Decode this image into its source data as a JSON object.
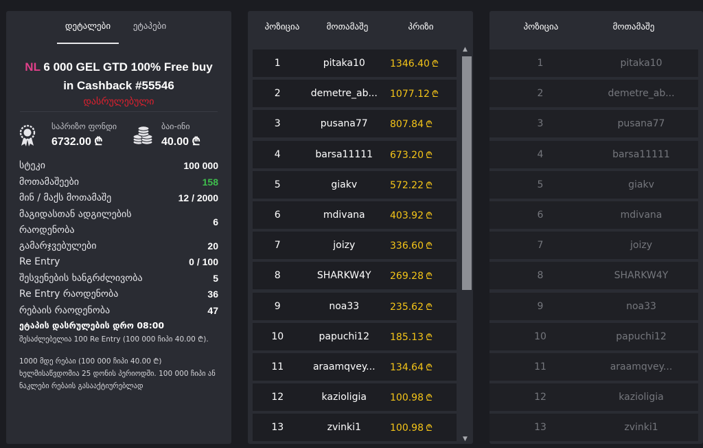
{
  "tabs": {
    "details": "დეტალები",
    "stages": "ეტაპები"
  },
  "tournament": {
    "prefix": "NL",
    "title": "6 000 GEL GTD 100% Free buy in Cashback #55546",
    "status": "დასრულებული"
  },
  "funds": {
    "prize_label": "საპრიზო ფონდი",
    "prize_value": "6732.00 ₾",
    "buyin_label": "ბაი-ინი",
    "buyin_value": "40.00 ₾"
  },
  "stats": [
    {
      "k": "სტეკი",
      "v": "100 000"
    },
    {
      "k": "მოთამაშეები",
      "v": "158"
    },
    {
      "k": "მინ / მაქს მოთამაშე",
      "v": "12 / 2000"
    },
    {
      "k": "მაგიდასთან ადგილების რაოდენობა",
      "v": "6"
    },
    {
      "k": "გამარჯვებულები",
      "v": "20"
    },
    {
      "k": "Re Entry",
      "v": "0 / 100"
    },
    {
      "k": "შესვენების ხანგრძლივობა",
      "v": "5"
    },
    {
      "k": "Re Entry რაოდენობა",
      "v": "36"
    },
    {
      "k": "რებაის რაოდენობა",
      "v": "47"
    }
  ],
  "notes": {
    "heading": "ეტაპის დასრულების დრო 08:00",
    "line1": "შესაძლებელია 100 Re Entry (100 000 ჩიპი 40.00 ₾).",
    "line2": "1000 მდე რებაი (100 000 ჩიპი 40.00 ₾) ხელმისაწვდომია 25 დონის პერიოდში. 100 000 ჩიპი ან ნაკლები რებაის გასააქტიურებლად"
  },
  "leaderboard": {
    "col_pos": "პოზიცია",
    "col_player": "მოთამაშე",
    "col_prize": "პრიზი",
    "rows": [
      {
        "pos": "1",
        "name": "pitaka10",
        "prize": "1346.40"
      },
      {
        "pos": "2",
        "name": "demetre_ab...",
        "prize": "1077.12"
      },
      {
        "pos": "3",
        "name": "pusana77",
        "prize": "807.84"
      },
      {
        "pos": "4",
        "name": "barsa11111",
        "prize": "673.20"
      },
      {
        "pos": "5",
        "name": "giakv",
        "prize": "572.22"
      },
      {
        "pos": "6",
        "name": "mdivana",
        "prize": "403.92"
      },
      {
        "pos": "7",
        "name": "joizy",
        "prize": "336.60"
      },
      {
        "pos": "8",
        "name": "SHARKW4Y",
        "prize": "269.28"
      },
      {
        "pos": "9",
        "name": "noa33",
        "prize": "235.62"
      },
      {
        "pos": "10",
        "name": "papuchi12",
        "prize": "185.13"
      },
      {
        "pos": "11",
        "name": "araamqvey...",
        "prize": "134.64"
      },
      {
        "pos": "12",
        "name": "kazioligia",
        "prize": "100.98"
      },
      {
        "pos": "13",
        "name": "zvinki1",
        "prize": "100.98"
      }
    ]
  },
  "players": {
    "col_pos": "პოზიცია",
    "col_player": "მოთამაშე",
    "rows": [
      {
        "pos": "1",
        "name": "pitaka10"
      },
      {
        "pos": "2",
        "name": "demetre_ab..."
      },
      {
        "pos": "3",
        "name": "pusana77"
      },
      {
        "pos": "4",
        "name": "barsa11111"
      },
      {
        "pos": "5",
        "name": "giakv"
      },
      {
        "pos": "6",
        "name": "mdivana"
      },
      {
        "pos": "7",
        "name": "joizy"
      },
      {
        "pos": "8",
        "name": "SHARKW4Y"
      },
      {
        "pos": "9",
        "name": "noa33"
      },
      {
        "pos": "10",
        "name": "papuchi12"
      },
      {
        "pos": "11",
        "name": "araamqvey..."
      },
      {
        "pos": "12",
        "name": "kazioligia"
      },
      {
        "pos": "13",
        "name": "zvinki1"
      }
    ]
  },
  "currency_symbol": "₾",
  "colors": {
    "accent_gold": "#f5c518",
    "status_red": "#e0202e",
    "prefix_pink": "#e0408a",
    "green": "#3fbf4d"
  }
}
